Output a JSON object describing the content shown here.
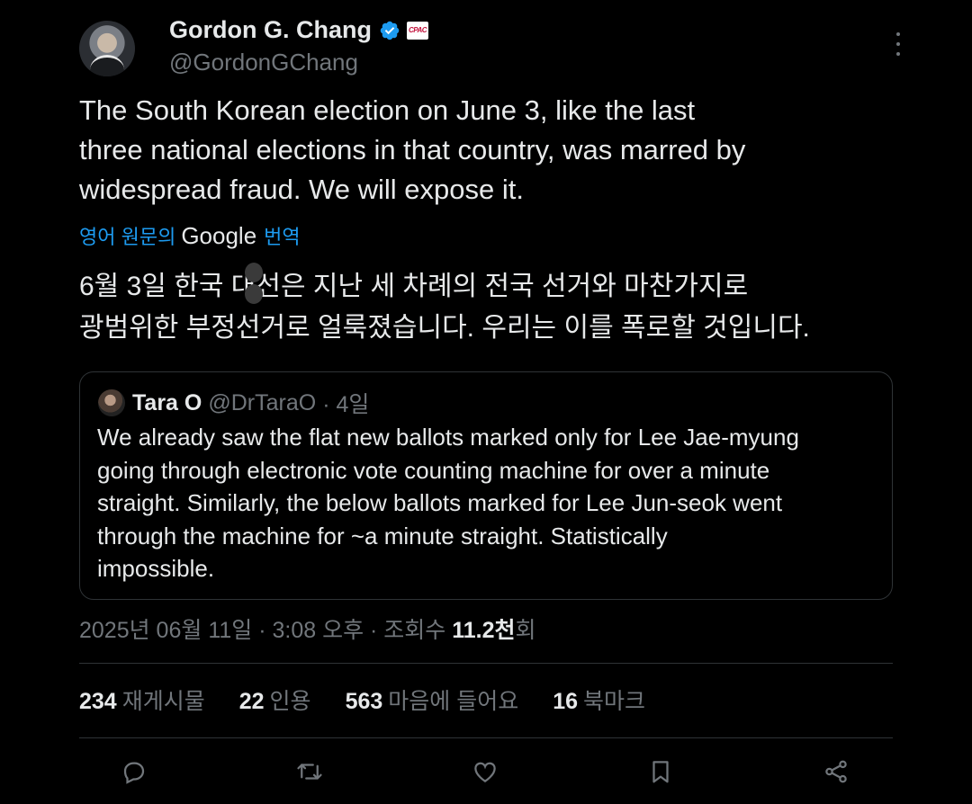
{
  "author": {
    "name": "Gordon G. Chang",
    "handle": "@GordonGChang",
    "affiliation_badge": "CPAC",
    "verified_color": "#1d9bf0"
  },
  "tweet": {
    "text": "The South Korean election on June 3, like the last\nthree national elections in that country, was marred by\nwidespread fraud. We will expose it.",
    "translate_prefix": "영어 원문의",
    "translate_brand": "Google",
    "translate_suffix": "번역",
    "translated_text": "6월 3일 한국 대선은 지난 세 차례의 전국 선거와 마찬가지로\n광범위한 부정선거로 얼룩졌습니다. 우리는 이를 폭로할 것입니다."
  },
  "quoted_tweet": {
    "name": "Tara O",
    "handle": "@DrTaraO",
    "time": "· 4일",
    "text": "We already saw the flat new ballots marked only for Lee Jae-myung\ngoing through electronic vote counting machine for over a minute\nstraight. Similarly, the below ballots marked for Lee Jun-seok went\nthrough the machine for ~a minute straight. Statistically\nimpossible."
  },
  "meta": {
    "timestamp": "2025년 06월 11일 · 3:08 오후 · 조회수 ",
    "views": "11.2천",
    "views_suffix": "회"
  },
  "stats": [
    {
      "count": "234",
      "label": "재게시물"
    },
    {
      "count": "22",
      "label": "인용"
    },
    {
      "count": "563",
      "label": "마음에 들어요"
    },
    {
      "count": "16",
      "label": "북마크"
    }
  ],
  "actions": [
    "reply-icon",
    "repost-icon",
    "like-icon",
    "bookmark-icon",
    "share-icon"
  ],
  "colors": {
    "background": "#000000",
    "text": "#e7e9ea",
    "muted": "#71767b",
    "link": "#1d9bf0",
    "border": "#2f3336"
  }
}
